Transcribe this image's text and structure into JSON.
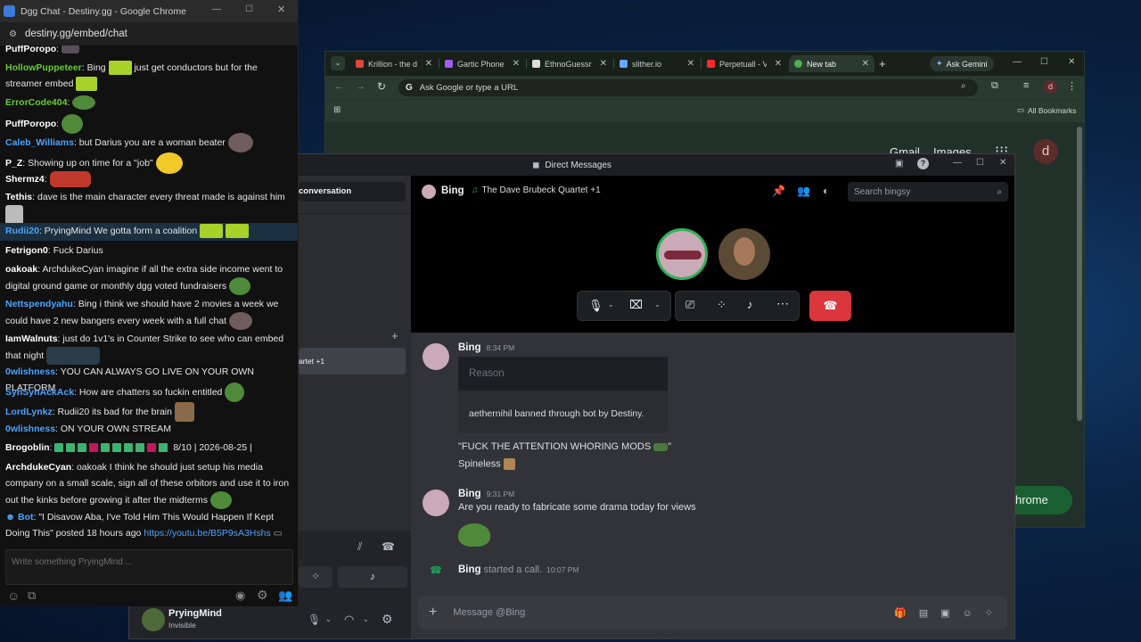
{
  "chat_window": {
    "title": "Dgg Chat - Destiny.gg - Google Chrome",
    "url": "destiny.gg/embed/chat",
    "input_placeholder": "Write something PryingMind ...",
    "lines": [
      {
        "user": "PuffPoropo",
        "color": "#ffffff",
        "text": ""
      },
      {
        "user": "HollowPuppeteer",
        "color": "#66cc33",
        "text": "Bing",
        "text2": "just get conductors but for the streamer embed"
      },
      {
        "user": "ErrorCode404",
        "color": "#66cc33",
        "text": ""
      },
      {
        "user": "PuffPoropo",
        "color": "#ffffff",
        "text": ""
      },
      {
        "user": "Caleb_Williams",
        "color": "#4aa3ff",
        "text": "but Darius you are a woman beater"
      },
      {
        "user": "P_Z",
        "color": "#ffffff",
        "text": "Showing up on time for a \"job\""
      },
      {
        "user": "Shermz4",
        "color": "#ffffff",
        "text": ""
      },
      {
        "user": "Tethis",
        "color": "#ffffff",
        "text": "dave is the main character every threat made is against him"
      },
      {
        "user": "Rudii20",
        "color": "#4aa3ff",
        "text": "PryingMind We gotta form a coalition"
      },
      {
        "user": "Fetrigon0",
        "color": "#ffffff",
        "text": "Fuck Darius"
      },
      {
        "user": "oakoak",
        "color": "#ffffff",
        "text": "ArchdukeCyan imagine if all the extra side income went to digital ground game or monthly dgg voted fundraisers"
      },
      {
        "user": "Nettspendyahu",
        "color": "#4aa3ff",
        "text": "Bing i think we should have 2 movies a week we could have 2 new bangers every week with a full chat"
      },
      {
        "user": "IamWalnuts",
        "color": "#ffffff",
        "text": "just do 1v1's in Counter Strike to see who can embed that night"
      },
      {
        "user": "0wlishness",
        "color": "#4aa3ff",
        "text": "YOU CAN ALWAYS GO LIVE ON YOUR OWN PLATFORM"
      },
      {
        "user": "SynSynAckAck",
        "color": "#4aa3ff",
        "text": "How are chatters so fuckin entitled"
      },
      {
        "user": "LordLynkz",
        "color": "#4aa3ff",
        "text": "Rudii20 its bad for the brain"
      },
      {
        "user": "0wlishness",
        "color": "#4aa3ff",
        "text": "ON YOUR OWN STREAM"
      },
      {
        "user": "Brogoblin",
        "color": "#ffffff",
        "text": "8/10 | 2026-08-25 |"
      },
      {
        "user": "ArchdukeCyan",
        "color": "#ffffff",
        "text": "oakoak I think he should just setup his media company on a small scale, sign all of these orbitors and use it to iron out the kinks before growing it after the midterms"
      },
      {
        "user": "Bot",
        "color": "#4aa3ff",
        "text": "\"I Disavow Aba, I've Told Him This Would Happen If Kept Doing This\" posted 18 hours ago",
        "link": "https://youtu.be/B5P9sA3Hshs"
      }
    ]
  },
  "chrome": {
    "tabs": [
      {
        "label": "Krillion - the d",
        "color": "#e0443a"
      },
      {
        "label": "Gartic Phone",
        "color": "#a05cf0"
      },
      {
        "label": "EthnoGuessr",
        "color": "#dddddd"
      },
      {
        "label": "slither.io",
        "color": "#6aa5ff"
      },
      {
        "label": "Perpetuall - V",
        "color": "#ff2a2a"
      },
      {
        "label": "New tab",
        "color": "#4caf50"
      }
    ],
    "ask_gemini": "Ask Gemini",
    "omnibox_placeholder": "Ask Google or type a URL",
    "all_bookmarks": "All Bookmarks",
    "gmail": "Gmail",
    "images": "Images",
    "profile_letter": "d",
    "chrome_button": "hrome"
  },
  "discord": {
    "title": "Direct Messages",
    "find_conversation": "conversation",
    "dm_partial": "artet +1",
    "header_name": "Bing",
    "header_activity": "The Dave Brubeck Quartet +1",
    "search_placeholder": "Search bingsy",
    "messages": [
      {
        "author": "Bing",
        "time": "8:34 PM",
        "embed_reason": "Reason",
        "embed_text": "aethernihil banned through bot by Destiny.",
        "line1": "\"FUCK THE ATTENTION WHORING MODS",
        "line1_end": "\"",
        "line2": "Spineless"
      },
      {
        "author": "Bing",
        "time": "9:31 PM",
        "text": "Are you ready to fabricate some drama today for views"
      }
    ],
    "call_started": {
      "author": "Bing",
      "text": "started a call.",
      "time": "10:07 PM"
    },
    "message_placeholder": "Message @Bing",
    "user": {
      "name": "PryingMind",
      "status": "Invisible"
    }
  }
}
